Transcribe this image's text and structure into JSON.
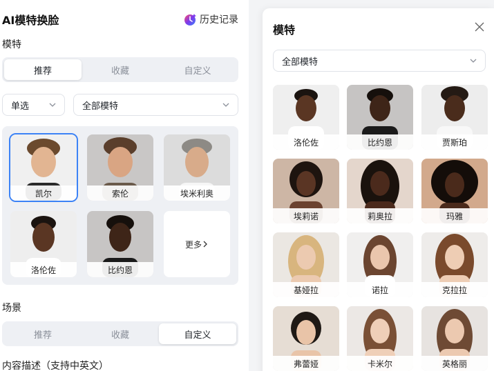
{
  "app": {
    "title": "AI模特换脸",
    "history_label": "历史记录"
  },
  "model_section": {
    "label": "模特",
    "tabs": [
      "推荐",
      "收藏",
      "自定义"
    ],
    "active_tab": "推荐",
    "mode_select": "单选",
    "category_select": "全部模特",
    "cards": [
      "凯尔",
      "索伦",
      "埃米利奥",
      "洛伦佐",
      "比约恩"
    ],
    "selected": "凯尔",
    "more_label": "更多"
  },
  "scene_section": {
    "label": "场景",
    "tabs": [
      "推荐",
      "收藏",
      "自定义"
    ],
    "active_tab": "自定义"
  },
  "description_label": "内容描述（支持中英文）",
  "modal": {
    "title": "模特",
    "category_select": "全部模特",
    "models": [
      "洛伦佐",
      "比约恩",
      "贾斯珀",
      "埃莉诺",
      "莉奥拉",
      "玛雅",
      "基娅拉",
      "诺拉",
      "克拉拉",
      "弗蕾娅",
      "卡米尔",
      "英格丽"
    ]
  },
  "colors": {
    "accent": "#3b82f6",
    "panel_bg": "#eef0f4"
  }
}
